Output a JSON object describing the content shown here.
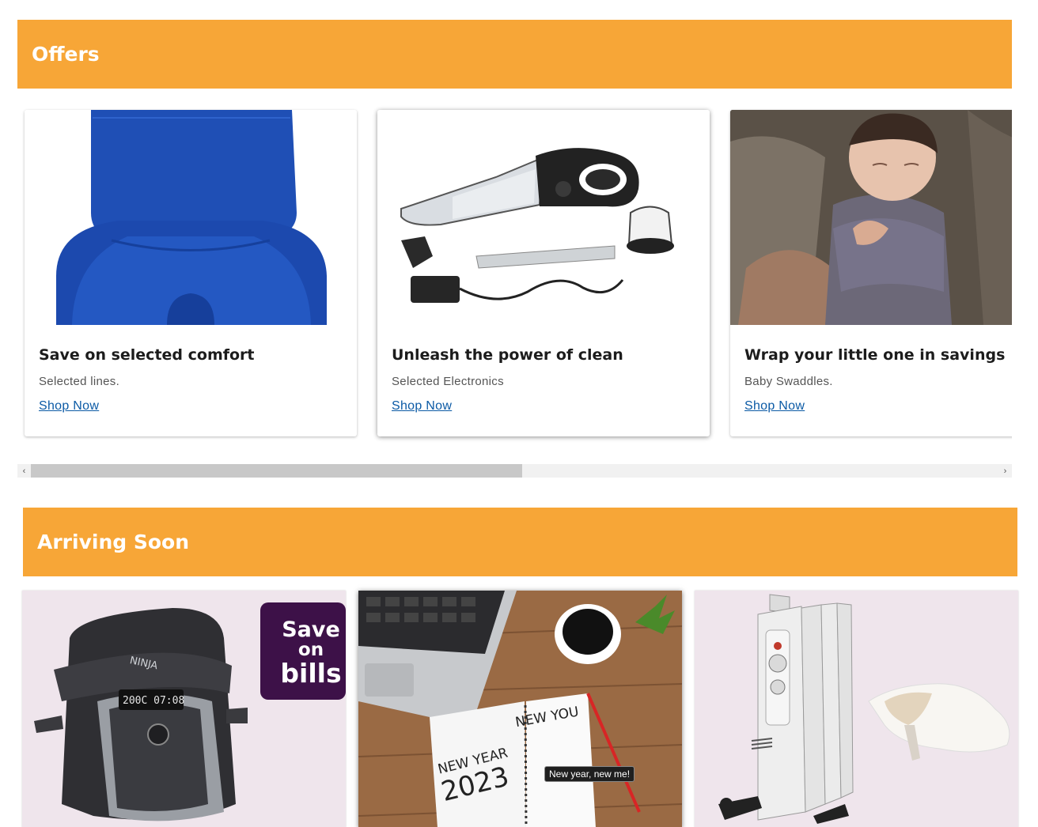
{
  "offers": {
    "heading": "Offers",
    "cards": [
      {
        "title": "Save on selected comfort",
        "subtitle": "Selected lines.",
        "link": "Shop Now",
        "image": "blue-seat-cushion"
      },
      {
        "title": "Unleash the power of clean",
        "subtitle": "Selected Electronics",
        "link": "Shop Now",
        "image": "handheld-vacuum"
      },
      {
        "title": "Wrap your little one in savings",
        "subtitle": "Baby Swaddles.",
        "link": "Shop Now",
        "image": "swaddled-baby"
      }
    ],
    "scrollbar": {
      "left_arrow": "‹",
      "right_arrow": "›"
    }
  },
  "arriving": {
    "heading": "Arriving Soon",
    "tiles": [
      {
        "image": "pressure-cooker",
        "badge": "Save on bills",
        "badge_lines": [
          "Save",
          "on",
          "bills"
        ],
        "display_text": "200C 07:08",
        "brand_text": "NINJA"
      },
      {
        "image": "new-year-notebook",
        "tooltip": "New year, new me!",
        "note_left": "NEW YEAR",
        "note_year": "2023",
        "note_right": "NEW YOU"
      },
      {
        "image": "oil-heater-and-slipper"
      }
    ]
  },
  "colors": {
    "band": "#f7a637",
    "link": "#0b5aa5",
    "badge": "#3d1148",
    "tile_bg": "#efe5ec"
  }
}
